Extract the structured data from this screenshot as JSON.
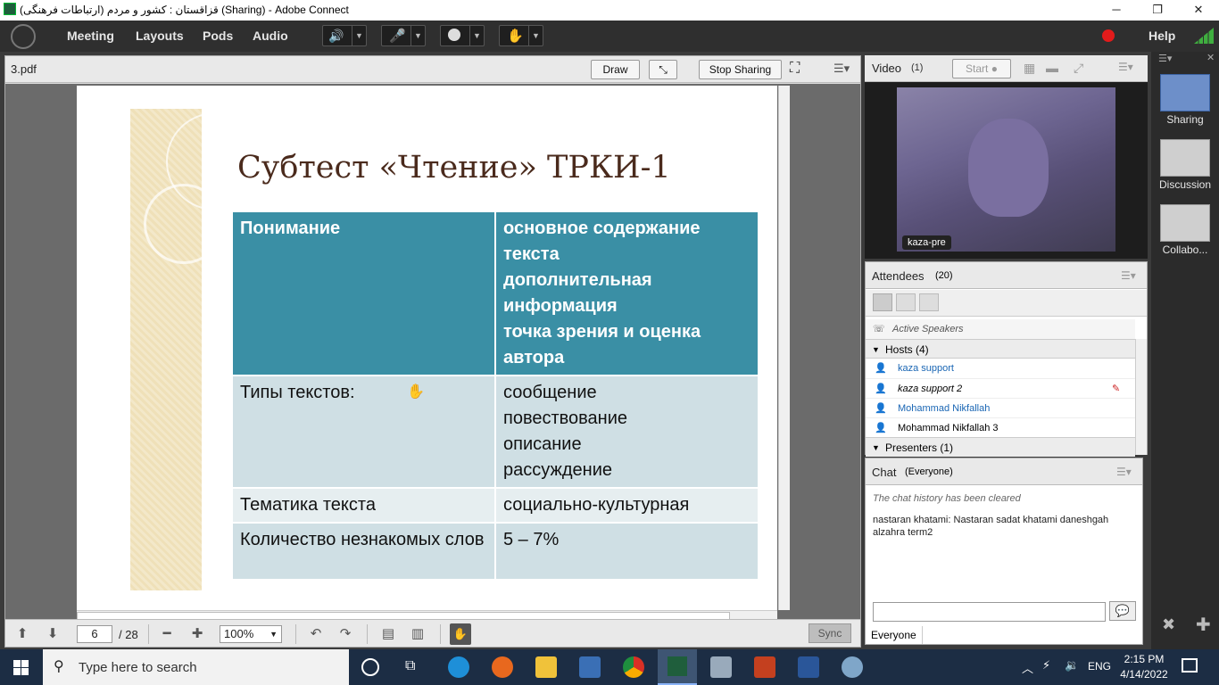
{
  "window": {
    "title": "قزاقستان : کشور و مردم (ارتباطات فرهنگی) (Sharing) - Adobe Connect",
    "minimize": "─",
    "restore": "❐",
    "close": "✕"
  },
  "menu": {
    "items": [
      "Meeting",
      "Layouts",
      "Pods",
      "Audio"
    ],
    "help": "Help"
  },
  "share_pod": {
    "title": "3.pdf",
    "draw": "Draw",
    "stop_sharing": "Stop Sharing"
  },
  "slide": {
    "title": "Субтест «Чтение» ТРКИ-1",
    "rows": [
      {
        "left": [
          "Понимание"
        ],
        "right": [
          "основное содержание текста",
          "дополнительная информация",
          "точка зрения и оценка автора"
        ]
      },
      {
        "left": [
          "Типы текстов:"
        ],
        "right": [
          "сообщение",
          "повествование",
          "описание",
          "рассуждение"
        ]
      },
      {
        "left": [
          "Тематика текста"
        ],
        "right": [
          "социально-культурная"
        ]
      },
      {
        "left": [
          "Количество незнакомых слов"
        ],
        "right": [
          "5 – 7%"
        ]
      }
    ]
  },
  "footer": {
    "page": "6",
    "total": "/ 28",
    "zoom": "100%",
    "sync": "Sync"
  },
  "video_pod": {
    "title": "Video",
    "count": "(1)",
    "start": "Start",
    "name": "kaza-pre"
  },
  "attendees": {
    "title": "Attendees",
    "count": "(20)",
    "active_speakers": "Active Speakers",
    "hosts": "Hosts (4)",
    "presenters": "Presenters (1)",
    "names": [
      "kaza support",
      "kaza support 2",
      "Mohammad Nikfallah",
      "Mohammad Nikfallah 3"
    ]
  },
  "chat": {
    "title": "Chat",
    "scope": "(Everyone)",
    "cleared": "The chat history has been cleared",
    "sender": "nastaran khatami:",
    "message": "Nastaran sadat khatami daneshgah alzahra term2",
    "tab": "Everyone"
  },
  "layouts": [
    "Sharing",
    "Discussion",
    "Collabo..."
  ],
  "taskbar": {
    "search": "Type here to search",
    "lang": "ENG",
    "time": "2:15 PM",
    "date": "4/14/2022"
  }
}
